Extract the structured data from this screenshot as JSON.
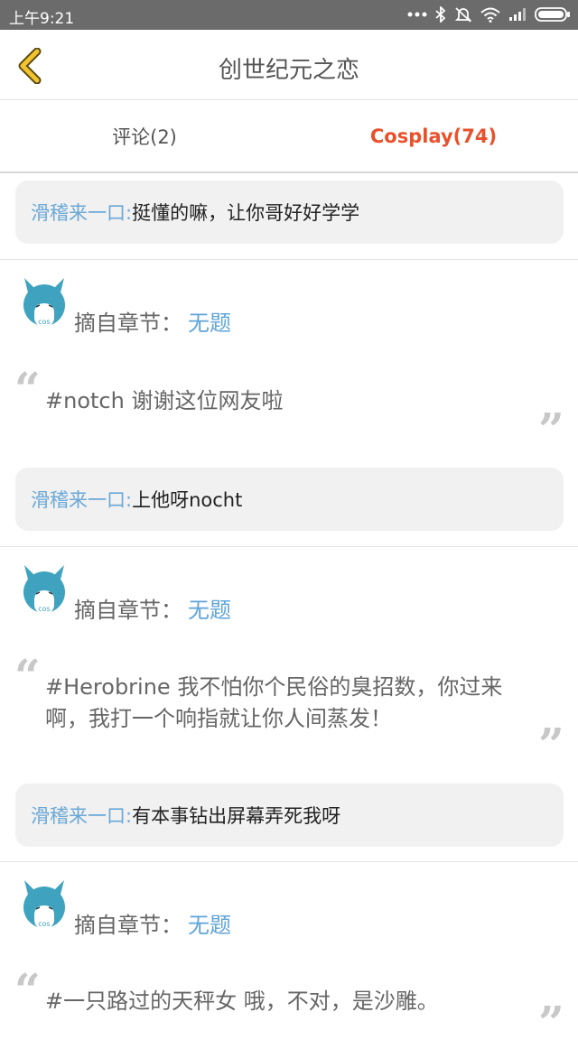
{
  "status_bar": {
    "time": "上午9:21",
    "icons": [
      "more-dots-icon",
      "bluetooth-icon",
      "mute-icon",
      "wifi-icon",
      "signal-icon",
      "battery-icon"
    ]
  },
  "nav": {
    "back_icon": "chevron-left-icon",
    "title": "创世纪元之恋"
  },
  "tabs": [
    {
      "label": "评论(2)",
      "active": false
    },
    {
      "label": "Cosplay(74)",
      "active": true
    }
  ],
  "colors": {
    "accent": "#e8512c",
    "link": "#5fa4d9",
    "status_bar": "#6b6b6b",
    "back_arrow": "#f2c230"
  },
  "feed": {
    "top_reply": {
      "author": "滑稽来一口:",
      "text": "挺懂的嘛，让你哥好好学学"
    },
    "posts": [
      {
        "chapter_label": "摘自章节：",
        "chapter_link": "无题",
        "quote_lines": [
          "#notch 谢谢这位网友啦"
        ],
        "reply": {
          "author": "滑稽来一口:",
          "text": "上他呀nocht"
        }
      },
      {
        "chapter_label": "摘自章节：",
        "chapter_link": "无题",
        "quote_lines": [
          "#Herobrine 我不怕你个民俗的臭招数，你过来",
          "啊，我打一个响指就让你人间蒸发！"
        ],
        "reply": {
          "author": "滑稽来一口:",
          "text": "有本事钻出屏幕弄死我呀"
        }
      },
      {
        "chapter_label": "摘自章节：",
        "chapter_link": "无题",
        "quote_lines": [
          "#一只路过的天秤女 哦，不对，是沙雕。"
        ]
      }
    ]
  }
}
